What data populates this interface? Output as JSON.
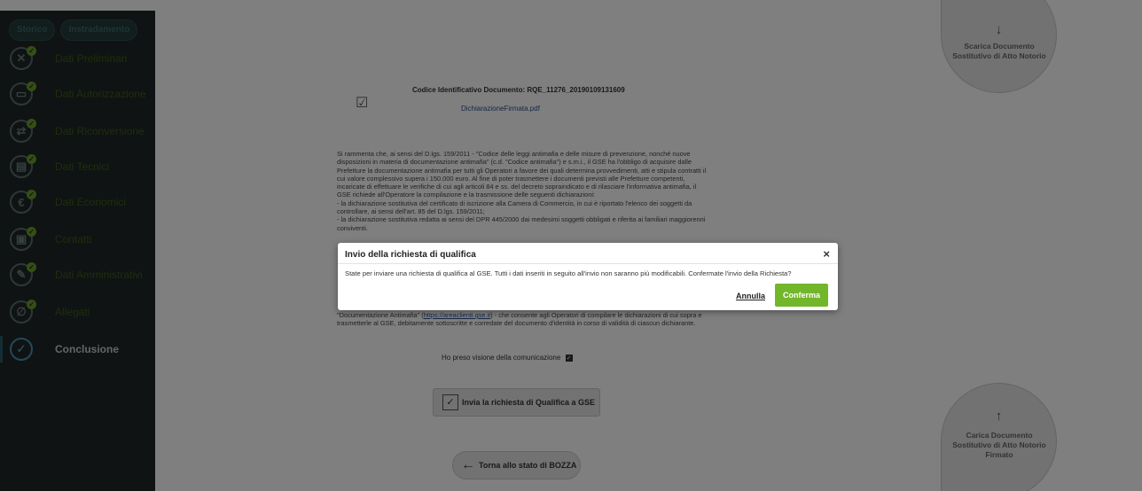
{
  "sidebar": {
    "tabs": [
      "Storico",
      "Instradamento"
    ],
    "items": [
      {
        "label": "Dati Preliminari",
        "icon": "tools-icon",
        "glyph": "✕"
      },
      {
        "label": "Dati Autorizzazione",
        "icon": "document-icon",
        "glyph": "▭"
      },
      {
        "label": "Dati Riconversione",
        "icon": "shuffle-icon",
        "glyph": "⇄"
      },
      {
        "label": "Dati Tecnici",
        "icon": "panel-icon",
        "glyph": "▤"
      },
      {
        "label": "Dati Economici",
        "icon": "euro-icon",
        "glyph": "€"
      },
      {
        "label": "Contatti",
        "icon": "contact-icon",
        "glyph": "▣"
      },
      {
        "label": "Dati Amministrativi",
        "icon": "admin-icon",
        "glyph": "✎"
      },
      {
        "label": "Allegati",
        "icon": "paperclip-icon",
        "glyph": "∅"
      },
      {
        "label": "Conclusione",
        "icon": "check-circle-icon",
        "glyph": "✓"
      }
    ]
  },
  "main": {
    "doc_code": "Codice Identificativo Documento: RQE_11276_20190109131609",
    "doc_link": "DichiarazioneFirmata.pdf",
    "paragraph": "Si rammenta che, ai sensi del D.lgs. 159/2011 - \"Codice delle leggi antimafia e delle misure di prevenzione, nonché nuove disposizioni in materia di documentazione antimafia\" (c.d. \"Codice antimafia\") e s.m.i., il GSE ha l'obbligo di acquisire dalle Prefetture la documentazione antimafia per tutti gli Operatori a favore dei quali determina provvedimenti, atti e stipula contratti il cui valore complessivo supera i 150.000 euro. Al fine di poter trasmettere i documenti previsti alle Prefetture competenti, incaricate di effettuare le verifiche di cui agli articoli 84 e ss. del decreto sopraindicato e di rilasciare l'informativa antimafia, il GSE richiede all'Operatore la compilazione e la trasmissione delle seguenti dichiarazioni:",
    "bullet1": "- la dichiarazione sostitutiva del certificato di iscrizione alla Camera di Commercio, in cui è riportato l'elenco dei soggetti da controllare, ai sensi dell'art. 85 del D.lgs. 159/2011;",
    "bullet2": "- la dichiarazione sostitutiva redatta ai sensi del DPR 445/2000 dai medesimi soggetti obbligati e riferita ai familiari maggiorenni conviventi.",
    "para2_pre": "\"Documentazione Antimafia\" (",
    "para2_link": "https://areaclienti.gse.it",
    "para2_post": ") - che consente agli Operatori di compilare le dichiarazioni di cui sopra e trasmetterle al GSE, debitamente sottoscritte e corredate del documento d'identità in corso di validità di ciascun dichiarante.",
    "seen_label": "Ho preso visione della comunicazione",
    "send_button": "Invia la richiesta di Qualifica a GSE",
    "back_button": "Torna allo stato di BOZZA",
    "download_label": "Scarica Documento Sostitutivo di Atto Notorio",
    "upload_label": "Carica Documento Sostitutivo di Atto Notorio Firmato"
  },
  "modal": {
    "title": "Invio della richiesta di qualifica",
    "close": "×",
    "body": "State per inviare una richiesta di qualifica al GSE. Tutti i dati inseriti in seguito all'invio non saranno più modificabili. Confermate l'invio della Richiesta?",
    "cancel": "Annulla",
    "confirm": "Conferma"
  },
  "colors": {
    "sidebar_bg": "#1f2626",
    "accent_green": "#72b62a",
    "overlay": "rgba(0,0,0,0.5)"
  }
}
